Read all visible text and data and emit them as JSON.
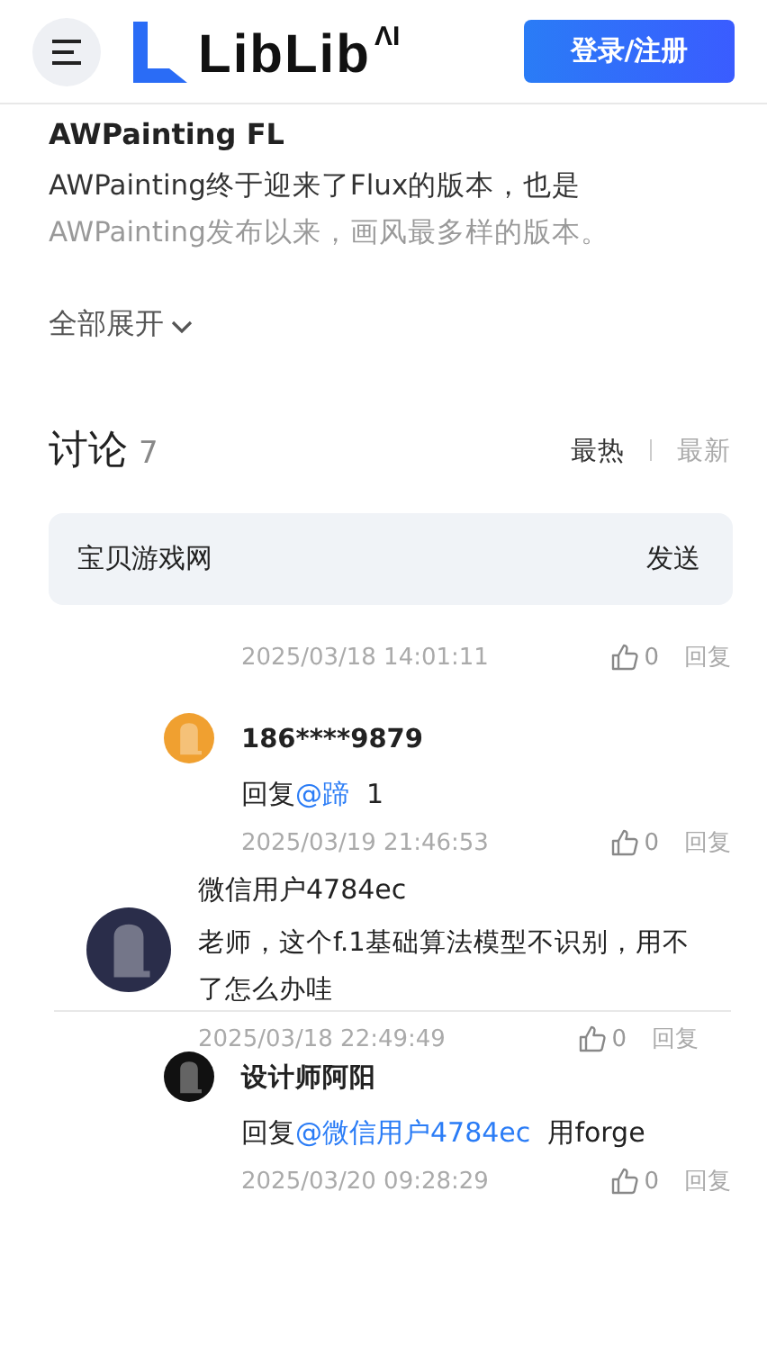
{
  "header": {
    "logo_text": "LibLib",
    "logo_super": "ΛI",
    "login_button": "登录/注册"
  },
  "article": {
    "title": "AWPainting FL",
    "description": "AWPainting终于迎来了Flux的版本，也是AWPainting发布以来，画风最多样的版本。",
    "expand_label": "全部展开"
  },
  "discussion": {
    "title": "讨论",
    "count": "7",
    "sort_tabs": [
      {
        "label": "最热",
        "selected": true
      },
      {
        "label": "最新",
        "selected": false
      }
    ],
    "comment_input": {
      "value": "宝贝游戏网",
      "send_label": "发送"
    }
  },
  "comments": [
    {
      "kind": "partial",
      "time": "2025/03/18 14:01:11",
      "likes": "0",
      "reply_label": "回复"
    },
    {
      "kind": "reply",
      "color": "#f0a030",
      "author": "186****9879",
      "prefix": "回复",
      "mention": "@蹄",
      "text": "1",
      "time": "2025/03/19 21:46:53",
      "likes": "0",
      "reply_label": "回复"
    },
    {
      "kind": "top",
      "color": "#2a2d4a",
      "author": "微信用户4784ec",
      "text": "老师，这个f.1基础算法模型不识别，用不了怎么办哇",
      "time": "2025/03/18 22:49:49",
      "likes": "0",
      "reply_label": "回复"
    },
    {
      "kind": "reply",
      "color": "#111111",
      "author": "设计师阿阳",
      "prefix": "回复",
      "mention": "@微信用户4784ec",
      "text": "用forge",
      "time": "2025/03/20 09:28:29",
      "likes": "0",
      "reply_label": "回复"
    }
  ]
}
